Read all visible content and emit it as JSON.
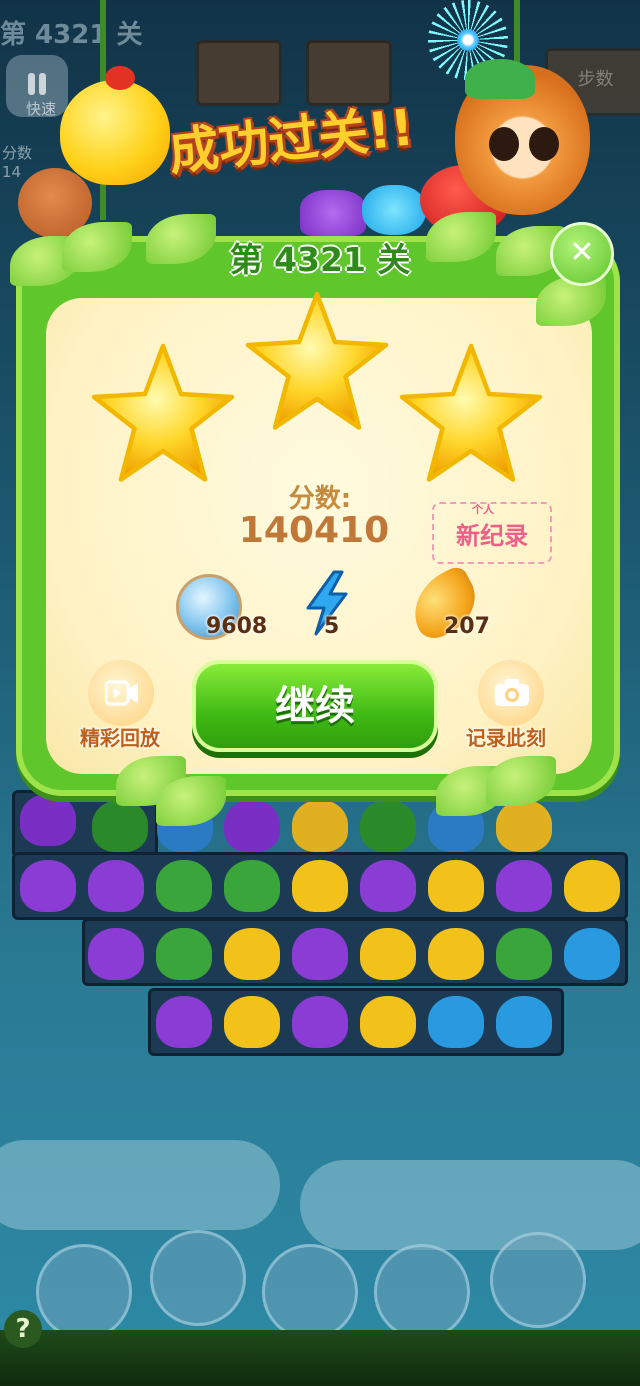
{
  "hud": {
    "level_label": "第 4321 关",
    "speed_label": "快速",
    "score_label": "分数",
    "score_partial": "14",
    "right_sign_label": "步数"
  },
  "banner": {
    "text": "成功过关!!"
  },
  "dialog": {
    "level_title": "第 4321 关",
    "close_glyph": "✕",
    "stars_earned": 3,
    "score_label": "分数:",
    "score_value": "140410",
    "record_badge": "新纪录",
    "record_badge_small": "个人",
    "rewards": [
      {
        "icon": "coin-icon",
        "value": "9608"
      },
      {
        "icon": "lightning-icon",
        "value": "5"
      },
      {
        "icon": "golden-bean-icon",
        "value": "207"
      }
    ],
    "replay_label": "精彩回放",
    "continue_label": "继续",
    "snapshot_label": "记录此刻"
  },
  "help_glyph": "?",
  "colors": {
    "panel_green": "#5fc62b",
    "button_green": "#3fba14",
    "banner_yellow": "#ffcf2e",
    "score_brown": "#c07838",
    "record_pink": "#ef5f8a"
  }
}
